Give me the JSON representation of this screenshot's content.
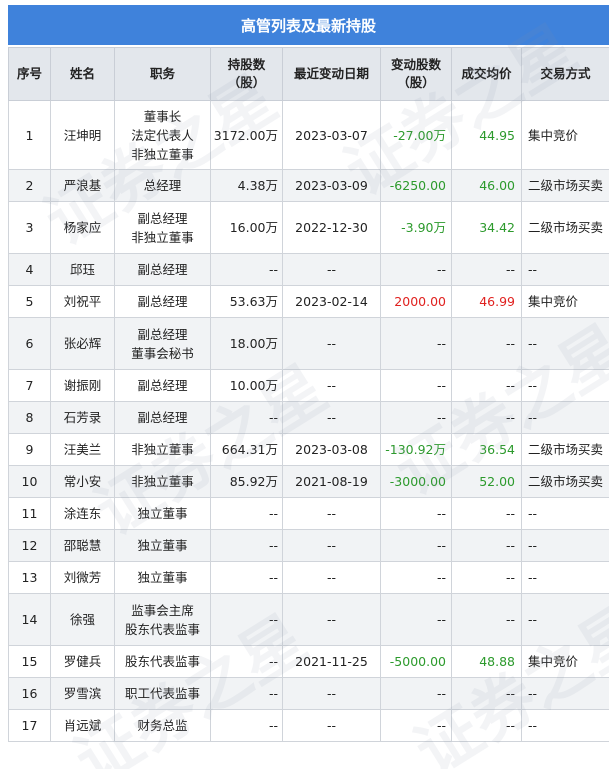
{
  "title": "高管列表及最新持股",
  "headers": {
    "no": "序号",
    "name": "姓名",
    "position": "职务",
    "holding": [
      "持股数",
      "（股）"
    ],
    "date": "最近变动日期",
    "change": [
      "变动股数",
      "（股）"
    ],
    "price": "成交均价",
    "mode": "交易方式"
  },
  "colors": {
    "header_bar": "#3f82db",
    "negative": "#2c9a2c",
    "positive": "#e0211f"
  },
  "watermark": "证券之星",
  "rows": [
    {
      "no": "1",
      "name": "汪坤明",
      "position": [
        "董事长",
        "法定代表人",
        "非独立董事"
      ],
      "holding": "3172.00万",
      "date": "2023-03-07",
      "change": "-27.00万",
      "change_sign": "neg",
      "price": "44.95",
      "price_sign": "neg",
      "mode": "集中竞价"
    },
    {
      "no": "2",
      "name": "严浪基",
      "position": [
        "总经理"
      ],
      "holding": "4.38万",
      "date": "2023-03-09",
      "change": "-6250.00",
      "change_sign": "neg",
      "price": "46.00",
      "price_sign": "neg",
      "mode": "二级市场买卖"
    },
    {
      "no": "3",
      "name": "杨家应",
      "position": [
        "副总经理",
        "非独立董事"
      ],
      "holding": "16.00万",
      "date": "2022-12-30",
      "change": "-3.90万",
      "change_sign": "neg",
      "price": "34.42",
      "price_sign": "neg",
      "mode": "二级市场买卖"
    },
    {
      "no": "4",
      "name": "邱珏",
      "position": [
        "副总经理"
      ],
      "holding": "--",
      "date": "--",
      "change": "--",
      "change_sign": "",
      "price": "--",
      "price_sign": "",
      "mode": "--"
    },
    {
      "no": "5",
      "name": "刘祝平",
      "position": [
        "副总经理"
      ],
      "holding": "53.63万",
      "date": "2023-02-14",
      "change": "2000.00",
      "change_sign": "pos",
      "price": "46.99",
      "price_sign": "pos",
      "mode": "集中竞价"
    },
    {
      "no": "6",
      "name": "张必辉",
      "position": [
        "副总经理",
        "董事会秘书"
      ],
      "holding": "18.00万",
      "date": "--",
      "change": "--",
      "change_sign": "",
      "price": "--",
      "price_sign": "",
      "mode": "--"
    },
    {
      "no": "7",
      "name": "谢振刚",
      "position": [
        "副总经理"
      ],
      "holding": "10.00万",
      "date": "--",
      "change": "--",
      "change_sign": "",
      "price": "--",
      "price_sign": "",
      "mode": "--"
    },
    {
      "no": "8",
      "name": "石芳录",
      "position": [
        "副总经理"
      ],
      "holding": "--",
      "date": "--",
      "change": "--",
      "change_sign": "",
      "price": "--",
      "price_sign": "",
      "mode": "--"
    },
    {
      "no": "9",
      "name": "汪美兰",
      "position": [
        "非独立董事"
      ],
      "holding": "664.31万",
      "date": "2023-03-08",
      "change": "-130.92万",
      "change_sign": "neg",
      "price": "36.54",
      "price_sign": "neg",
      "mode": "二级市场买卖"
    },
    {
      "no": "10",
      "name": "常小安",
      "position": [
        "非独立董事"
      ],
      "holding": "85.92万",
      "date": "2021-08-19",
      "change": "-3000.00",
      "change_sign": "neg",
      "price": "52.00",
      "price_sign": "neg",
      "mode": "二级市场买卖"
    },
    {
      "no": "11",
      "name": "涂连东",
      "position": [
        "独立董事"
      ],
      "holding": "--",
      "date": "--",
      "change": "--",
      "change_sign": "",
      "price": "--",
      "price_sign": "",
      "mode": "--"
    },
    {
      "no": "12",
      "name": "邵聪慧",
      "position": [
        "独立董事"
      ],
      "holding": "--",
      "date": "--",
      "change": "--",
      "change_sign": "",
      "price": "--",
      "price_sign": "",
      "mode": "--"
    },
    {
      "no": "13",
      "name": "刘微芳",
      "position": [
        "独立董事"
      ],
      "holding": "--",
      "date": "--",
      "change": "--",
      "change_sign": "",
      "price": "--",
      "price_sign": "",
      "mode": "--"
    },
    {
      "no": "14",
      "name": "徐强",
      "position": [
        "监事会主席",
        "股东代表监事"
      ],
      "holding": "--",
      "date": "--",
      "change": "--",
      "change_sign": "",
      "price": "--",
      "price_sign": "",
      "mode": "--"
    },
    {
      "no": "15",
      "name": "罗健兵",
      "position": [
        "股东代表监事"
      ],
      "holding": "--",
      "date": "2021-11-25",
      "change": "-5000.00",
      "change_sign": "neg",
      "price": "48.88",
      "price_sign": "neg",
      "mode": "集中竞价"
    },
    {
      "no": "16",
      "name": "罗雪滨",
      "position": [
        "职工代表监事"
      ],
      "holding": "--",
      "date": "--",
      "change": "--",
      "change_sign": "",
      "price": "--",
      "price_sign": "",
      "mode": "--"
    },
    {
      "no": "17",
      "name": "肖远斌",
      "position": [
        "财务总监"
      ],
      "holding": "--",
      "date": "--",
      "change": "--",
      "change_sign": "",
      "price": "--",
      "price_sign": "",
      "mode": "--"
    }
  ]
}
